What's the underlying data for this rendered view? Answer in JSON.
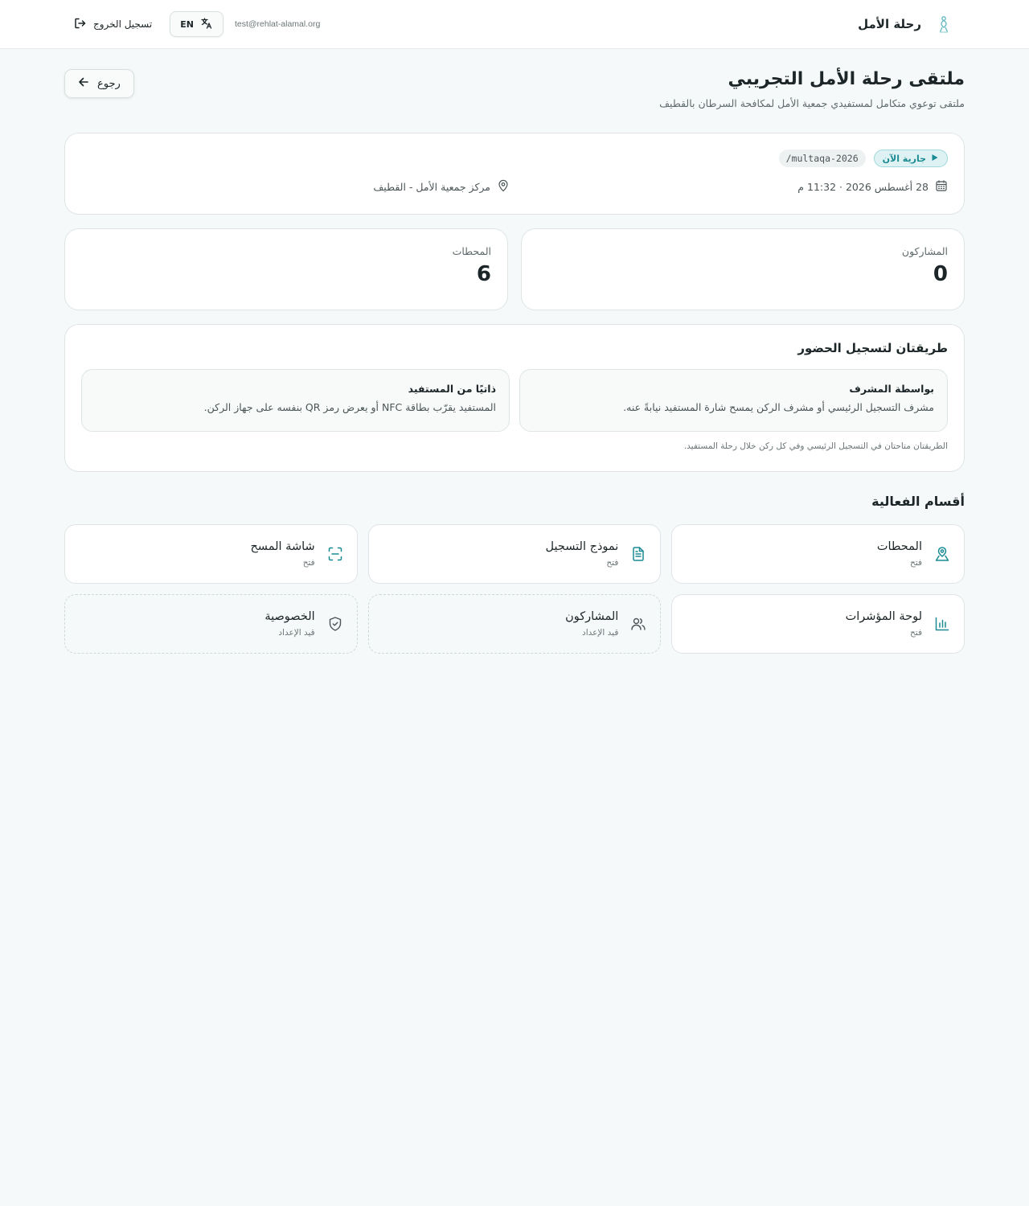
{
  "header": {
    "brand_name": "رحلة الأمل",
    "user_email": "test@rehlat-alamal.org",
    "lang_label": "EN",
    "logout_label": "تسجيل الخروج"
  },
  "page": {
    "title": "ملتقى رحلة الأمل التجريبي",
    "subtitle": "ملتقى توعوي متكامل لمستفيدي جمعية الأمل لمكافحة السرطان بالقطيف",
    "back_label": "رجوع"
  },
  "event_info": {
    "status": "جارية الآن",
    "slug": "/multaqa-2026",
    "datetime": "28 أغسطس 2026 · 11:32 م",
    "location": "مركز جمعية الأمل - القطيف"
  },
  "stats": [
    {
      "label": "المشاركون",
      "value": "0"
    },
    {
      "label": "المحطات",
      "value": "6"
    }
  ],
  "attendance": {
    "title": "طريقتان لتسجيل الحضور",
    "methods": [
      {
        "title": "بواسطة المشرف",
        "description": "مشرف التسجيل الرئيسي أو مشرف الركن يمسح شارة المستفيد نيابةً عنه."
      },
      {
        "title": "ذاتيًا من المستفيد",
        "description": "المستفيد يقرّب بطاقة NFC أو يعرض رمز QR بنفسه على جهاز الركن."
      }
    ],
    "note": "الطريقتان متاحتان في التسجيل الرئيسي وفي كل ركن خلال رحلة المستفيد."
  },
  "sections": {
    "title": "أقسام الفعالية",
    "items": [
      {
        "title": "المحطات",
        "status": "فتح",
        "icon": "map-pin-icon"
      },
      {
        "title": "نموذج التسجيل",
        "status": "فتح",
        "icon": "document-icon"
      },
      {
        "title": "شاشة المسح",
        "status": "فتح",
        "icon": "scan-icon"
      },
      {
        "title": "لوحة المؤشرات",
        "status": "فتح",
        "icon": "bar-chart-icon"
      },
      {
        "title": "المشاركون",
        "status": "قيد الإعداد",
        "icon": "users-icon"
      },
      {
        "title": "الخصوصية",
        "status": "قيد الإعداد",
        "icon": "shield-check-icon"
      }
    ]
  },
  "colors": {
    "accent": "#1a8a93",
    "background": "#f6f9f9",
    "card": "#ffffff",
    "text": "#1c2527"
  }
}
